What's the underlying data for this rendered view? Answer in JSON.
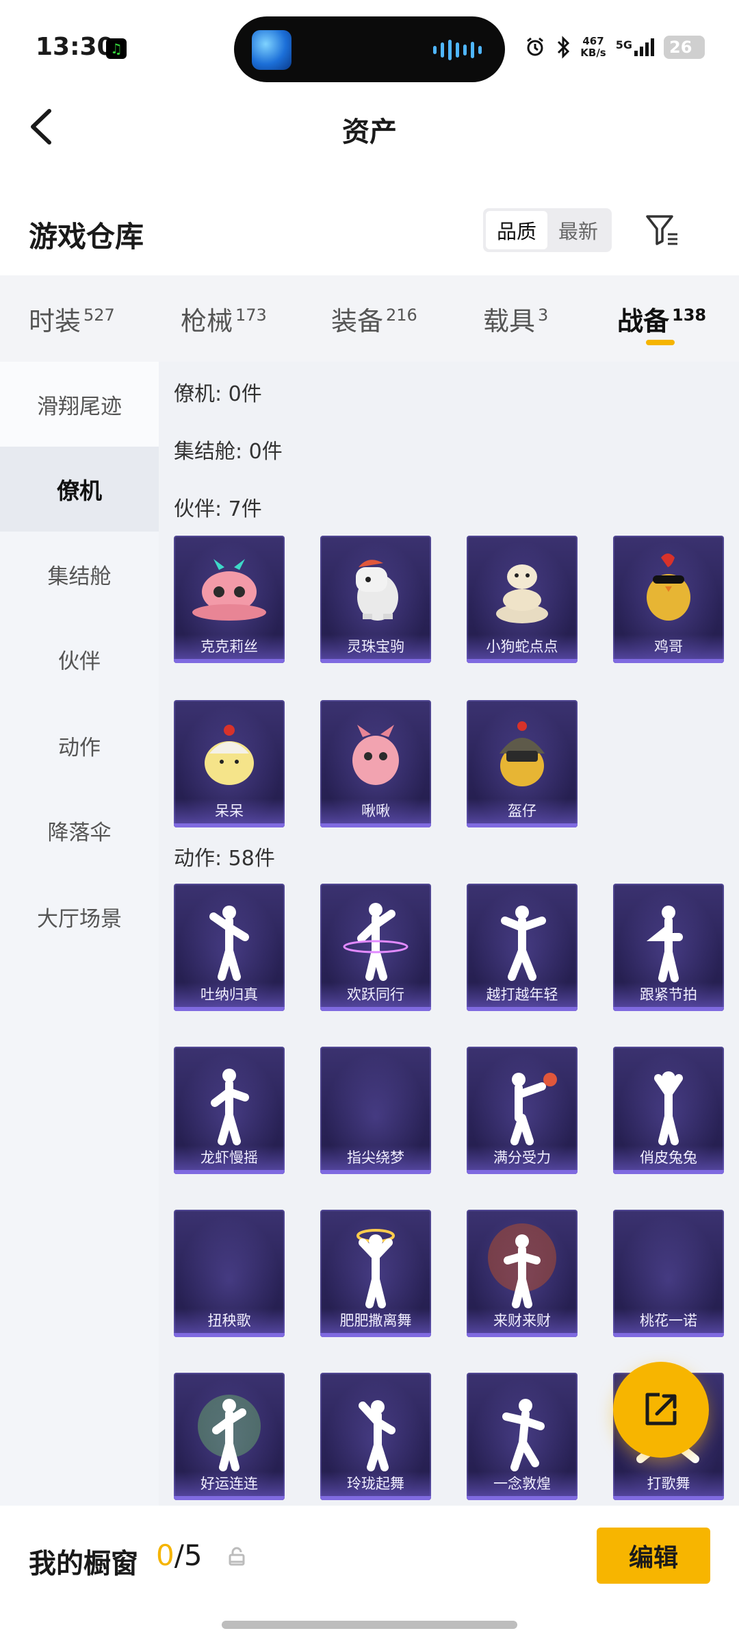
{
  "status_bar": {
    "time": "13:30",
    "net_speed_value": "467",
    "net_speed_unit": "KB/s",
    "network": "5G",
    "battery": "26"
  },
  "header": {
    "title": "资产",
    "back_icon": "chevron-left-icon"
  },
  "section": {
    "title": "游戏仓库",
    "sort_options": [
      "品质",
      "最新"
    ],
    "sort_selected": "品质",
    "filter_icon": "filter-icon"
  },
  "category_tabs": [
    {
      "label": "时装",
      "count": "527",
      "active": false
    },
    {
      "label": "枪械",
      "count": "173",
      "active": false
    },
    {
      "label": "装备",
      "count": "216",
      "active": false
    },
    {
      "label": "载具",
      "count": "3",
      "active": false
    },
    {
      "label": "战备",
      "count": "138",
      "active": true
    }
  ],
  "side_nav": [
    {
      "label": "滑翔尾迹",
      "active": false
    },
    {
      "label": "僚机",
      "active": true
    },
    {
      "label": "集结舱",
      "active": false
    },
    {
      "label": "伙伴",
      "active": false
    },
    {
      "label": "动作",
      "active": false
    },
    {
      "label": "降落伞",
      "active": false
    },
    {
      "label": "大厅场景",
      "active": false
    }
  ],
  "groups": {
    "wingman": "僚机: 0件",
    "rally_pod": "集结舱: 0件",
    "partner": "伙伴: 7件",
    "action": "动作: 58件"
  },
  "partners": [
    "克克莉丝",
    "灵珠宝驹",
    "小狗蛇点点",
    "鸡哥",
    "呆呆",
    "啾啾",
    "盔仔"
  ],
  "actions": [
    "吐纳归真",
    "欢跃同行",
    "越打越年轻",
    "跟紧节拍",
    "龙虾慢摇",
    "指尖绕梦",
    "满分受力",
    "俏皮兔兔",
    "扭秧歌",
    "肥肥撒离舞",
    "来财来财",
    "桃花一诺",
    "好运连连",
    "玲珑起舞",
    "一念敦煌",
    "打歌舞"
  ],
  "fab": {
    "icon": "share-external-icon"
  },
  "bottom_bar": {
    "label": "我的橱窗",
    "count_current": "0",
    "count_total": "/5",
    "lock_icon": "lock-icon",
    "edit_label": "编辑"
  },
  "colors": {
    "accent": "#f7b500",
    "card_bg": "#2a2358"
  }
}
